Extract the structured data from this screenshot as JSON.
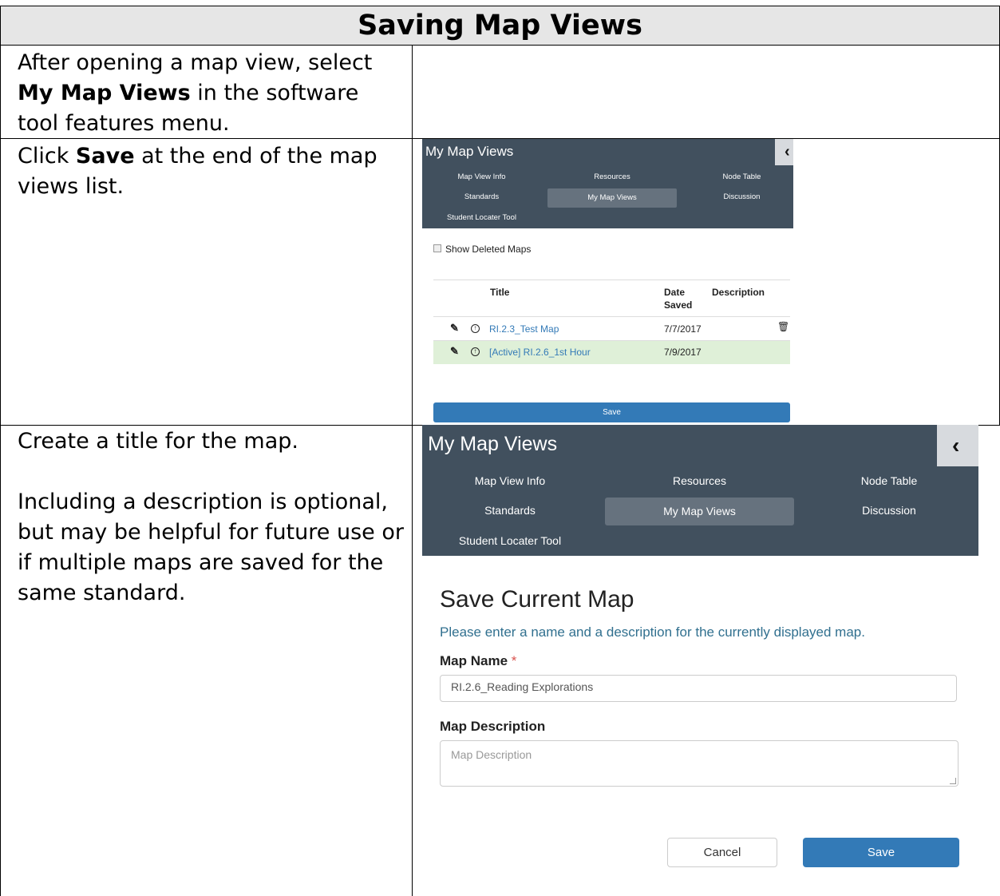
{
  "document": {
    "title": "Saving Map Views",
    "steps": [
      {
        "parts": [
          {
            "text": "After opening a map view, select "
          },
          {
            "text": "My Map Views",
            "bold": true
          },
          {
            "text": " in the software tool features menu."
          }
        ]
      },
      {
        "parts": [
          {
            "text": "Click "
          },
          {
            "text": "Save",
            "bold": true
          },
          {
            "text": " at the end of the map views list."
          }
        ]
      },
      {
        "para1": "Create a title for the map.",
        "para2": "Including a description is optional, but may be helpful for future use or if multiple maps are saved for the same standard."
      }
    ]
  },
  "panel_list": {
    "title": "My Map Views",
    "tabs": [
      "Map View Info",
      "Resources",
      "Node Table",
      "Standards",
      "My Map Views",
      "Discussion",
      "Student Locater Tool"
    ],
    "active_tab": "My Map Views",
    "show_deleted_label": "Show Deleted Maps",
    "columns": {
      "title": "Title",
      "date_saved": "Date Saved",
      "description": "Description"
    },
    "rows": [
      {
        "title": "RI.2.3_Test Map",
        "date": "7/7/2017",
        "active": false
      },
      {
        "title": "[Active] RI.2.6_1st Hour",
        "date": "7/9/2017",
        "active": true
      }
    ],
    "save_label": "Save"
  },
  "panel_form": {
    "title": "My Map Views",
    "tabs": [
      "Map View Info",
      "Resources",
      "Node Table",
      "Standards",
      "My Map Views",
      "Discussion",
      "Student Locater Tool"
    ],
    "active_tab": "My Map Views",
    "heading": "Save Current Map",
    "subtitle": "Please enter a name and a description for the currently displayed map.",
    "map_name_label": "Map Name",
    "required_mark": "*",
    "map_name_value": "RI.2.6_Reading Explorations",
    "map_description_label": "Map Description",
    "map_description_placeholder": "Map Description",
    "cancel_label": "Cancel",
    "save_label": "Save"
  },
  "colors": {
    "header_bg": "#41505e",
    "active_tab_bg": "#66727e",
    "primary": "#337ab7",
    "active_row_bg": "#dff0d8",
    "title_band": "#e6e6e6"
  }
}
